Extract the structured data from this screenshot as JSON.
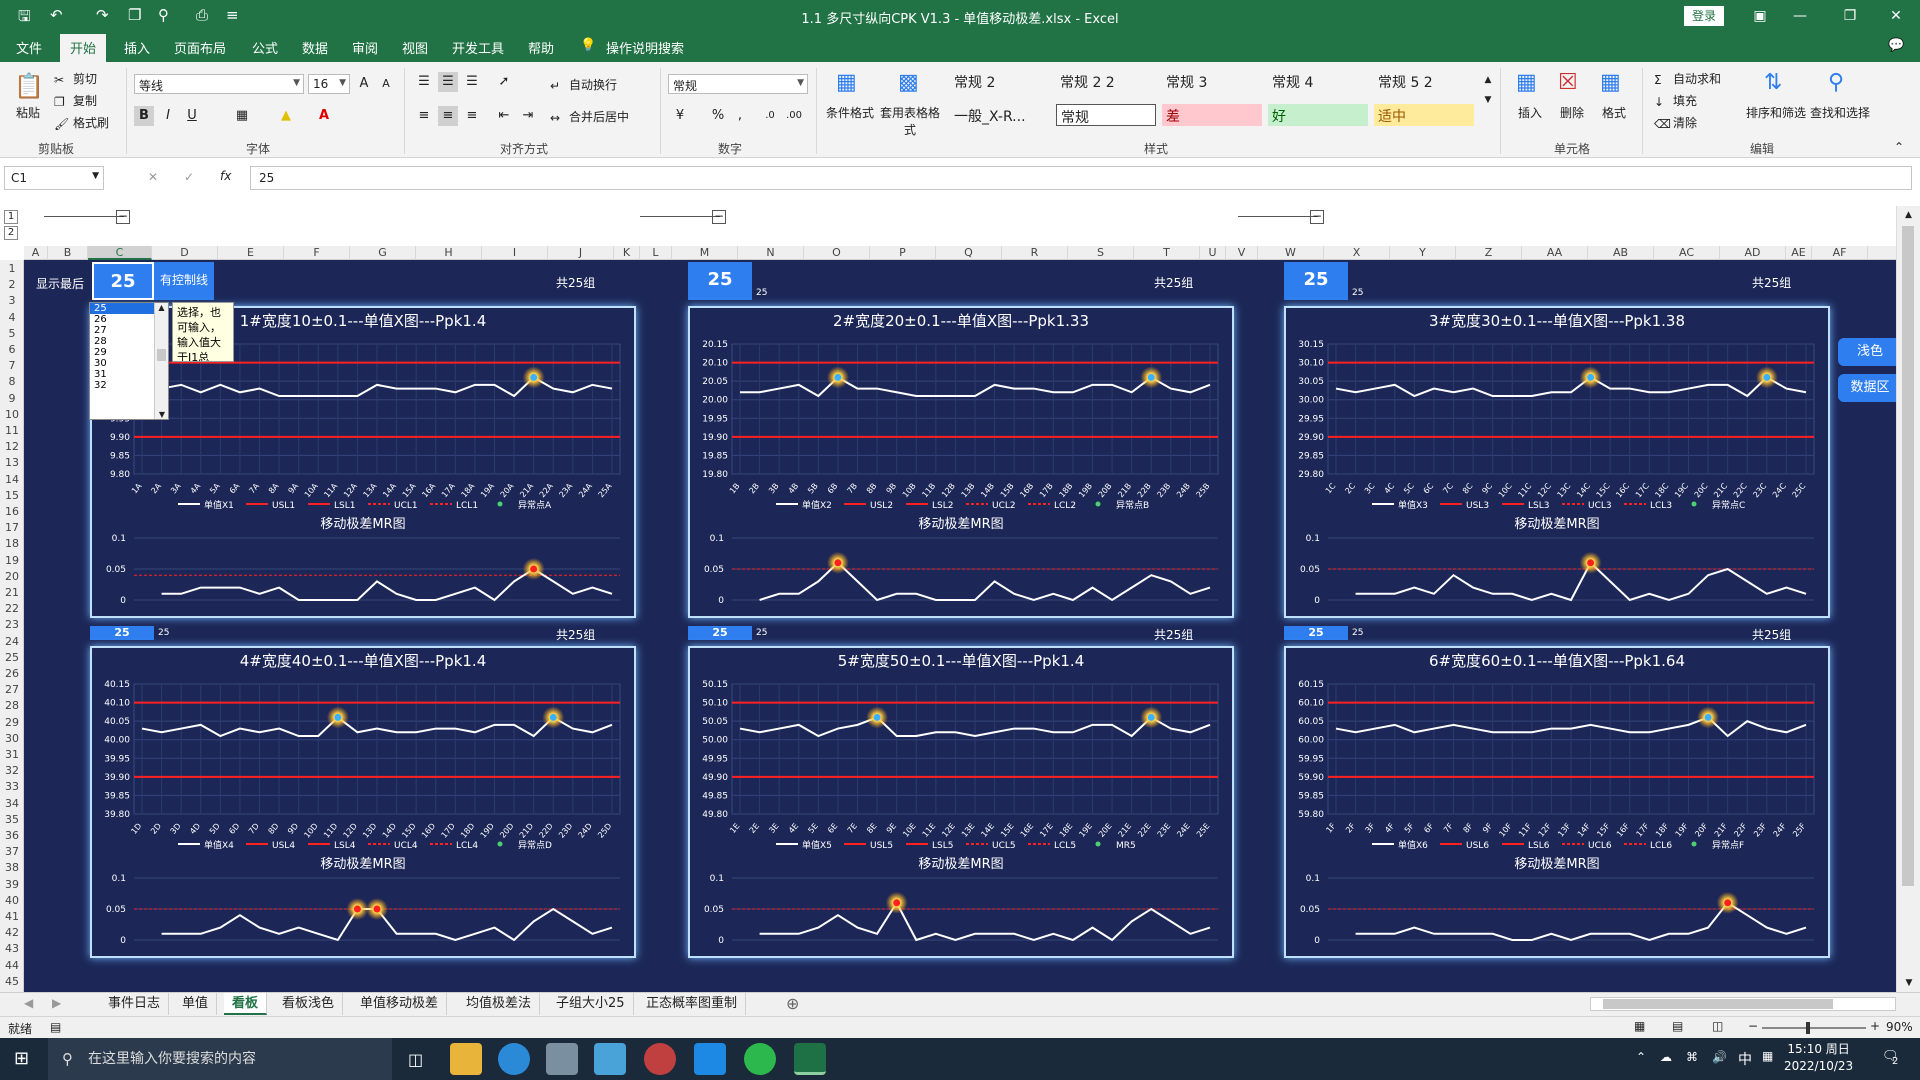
{
  "window": {
    "title": "1.1 多尺寸纵向CPK V1.3 - 单值移动极差.xlsx  -  Excel",
    "login": "登录"
  },
  "ribbon_tabs": [
    "文件",
    "开始",
    "插入",
    "页面布局",
    "公式",
    "数据",
    "审阅",
    "视图",
    "开发工具",
    "帮助",
    "操作说明搜索"
  ],
  "ribbon": {
    "clipboard": {
      "paste": "粘贴",
      "cut": "剪切",
      "copy": "复制",
      "format_painter": "格式刷",
      "group": "剪贴板"
    },
    "font": {
      "name": "等线",
      "size": "16",
      "bold": "B",
      "italic": "I",
      "underline": "U",
      "grow": "A",
      "shrink": "A",
      "group": "字体"
    },
    "alignment": {
      "wrap": "自动换行",
      "merge": "合并后居中",
      "group": "对齐方式"
    },
    "number": {
      "format": "常规",
      "percent": "%",
      "comma": ",",
      "group": "数字"
    },
    "styles": {
      "conditional": "条件格式",
      "table": "套用表格格式",
      "cells": [
        {
          "label": "常规 2",
          "bg": "#f3f3f3",
          "fg": "#222222"
        },
        {
          "label": "常规 2 2",
          "bg": "#f3f3f3",
          "fg": "#222222"
        },
        {
          "label": "常规 3",
          "bg": "#f3f3f3",
          "fg": "#222222"
        },
        {
          "label": "常规 4",
          "bg": "#f3f3f3",
          "fg": "#222222"
        },
        {
          "label": "常规 5 2",
          "bg": "#f3f3f3",
          "fg": "#222222"
        },
        {
          "label": "一般_X-R...",
          "bg": "#f3f3f3",
          "fg": "#222222"
        },
        {
          "label": "常规",
          "bg": "#ffffff",
          "fg": "#222222"
        },
        {
          "label": "差",
          "bg": "#ffc7ce",
          "fg": "#9c0006"
        },
        {
          "label": "好",
          "bg": "#c6efce",
          "fg": "#006100"
        },
        {
          "label": "适中",
          "bg": "#ffeb9c",
          "fg": "#9c5700"
        }
      ],
      "group": "样式"
    },
    "cells_group": {
      "insert": "插入",
      "delete": "删除",
      "format": "格式",
      "group": "单元格"
    },
    "editing": {
      "autosum": "自动求和",
      "fill": "填充",
      "clear": "清除",
      "sort": "排序和筛选",
      "find": "查找和选择",
      "group": "编辑"
    }
  },
  "formula_bar": {
    "namebox": "C1",
    "value": "25",
    "fx": "fx"
  },
  "columns": [
    "A",
    "B",
    "C",
    "D",
    "E",
    "F",
    "G",
    "H",
    "I",
    "J",
    "K",
    "L",
    "M",
    "N",
    "O",
    "P",
    "Q",
    "R",
    "S",
    "T",
    "U",
    "V",
    "W",
    "X",
    "Y",
    "Z",
    "AA",
    "AB",
    "AC",
    "AD",
    "AE",
    "AF"
  ],
  "rows": [
    "1",
    "2",
    "3",
    "4",
    "5",
    "6",
    "7",
    "8",
    "9",
    "10",
    "11",
    "12",
    "13",
    "14",
    "15",
    "16",
    "17",
    "18",
    "19",
    "20",
    "21",
    "22",
    "23",
    "24",
    "25",
    "26",
    "27",
    "28",
    "29",
    "30",
    "31",
    "32",
    "33",
    "34",
    "35",
    "36",
    "37",
    "38",
    "39",
    "40",
    "41",
    "42",
    "43",
    "44",
    "45"
  ],
  "top_row": {
    "show_last_label": "显示最后",
    "value": "25",
    "control_line_label": "有控制线",
    "total_groups": "共25组",
    "small_value": "25"
  },
  "dropdown": {
    "options": [
      "25",
      "26",
      "27",
      "28",
      "29",
      "30",
      "31",
      "32"
    ],
    "selected": "25",
    "tooltip": "选择，也可输入，输入值大于J1总"
  },
  "side_buttons": {
    "light": "浅色",
    "data": "数据区"
  },
  "mr_title": "移动极差MR图",
  "mr_ticks": [
    "0.1",
    "0.05",
    "0"
  ],
  "charts": [
    {
      "title": "1#宽度10±0.1---单值X图---Ppk1.4",
      "suffix": "A",
      "yticks": [
        "10.15",
        "10.10",
        "10.05",
        "10.00",
        "9.95",
        "9.90",
        "9.85",
        "9.80"
      ],
      "legend": [
        "单值X1",
        "USL1",
        "LSL1",
        "UCL1",
        "LCL1",
        "异常点A"
      ],
      "chart_data": {
        "type": "line",
        "x": [
          "1A",
          "2A",
          "3A",
          "4A",
          "5A",
          "6A",
          "7A",
          "8A",
          "9A",
          "10A",
          "11A",
          "12A",
          "13A",
          "14A",
          "15A",
          "16A",
          "17A",
          "18A",
          "19A",
          "20A",
          "21A",
          "22A",
          "23A",
          "24A",
          "25A"
        ],
        "values": [
          10.02,
          10.03,
          10.04,
          10.02,
          10.04,
          10.02,
          10.03,
          10.01,
          10.01,
          10.01,
          10.01,
          10.01,
          10.04,
          10.03,
          10.03,
          10.03,
          10.02,
          10.04,
          10.04,
          10.01,
          10.06,
          10.03,
          10.02,
          10.04,
          10.03
        ],
        "usl": 10.1,
        "lsl": 9.9,
        "ylim": [
          9.8,
          10.15
        ],
        "anomaly_index": [
          20
        ],
        "mr": [
          0.01,
          0.01,
          0.02,
          0.02,
          0.02,
          0.01,
          0.02,
          0,
          0,
          0,
          0,
          0.03,
          0.01,
          0,
          0,
          0.01,
          0.02,
          0,
          0.03,
          0.05,
          0.03,
          0.01,
          0.02,
          0.01
        ],
        "mr_anomaly": [
          19
        ],
        "mr_limit": 0.04,
        "mr_ylim": [
          0,
          0.1
        ]
      }
    },
    {
      "title": "2#宽度20±0.1---单值X图---Ppk1.33",
      "suffix": "B",
      "yticks": [
        "20.15",
        "20.10",
        "20.05",
        "20.00",
        "19.95",
        "19.90",
        "19.85",
        "19.80"
      ],
      "legend": [
        "单值X2",
        "USL2",
        "LSL2",
        "UCL2",
        "LCL2",
        "异常点B"
      ],
      "chart_data": {
        "type": "line",
        "x": [
          "1B",
          "2B",
          "3B",
          "4B",
          "5B",
          "6B",
          "7B",
          "8B",
          "9B",
          "10B",
          "11B",
          "12B",
          "13B",
          "14B",
          "15B",
          "16B",
          "17B",
          "18B",
          "19B",
          "20B",
          "21B",
          "22B",
          "23B",
          "24B",
          "25B"
        ],
        "values": [
          20.02,
          20.02,
          20.03,
          20.04,
          20.01,
          20.06,
          20.03,
          20.03,
          20.02,
          20.01,
          20.01,
          20.01,
          20.01,
          20.04,
          20.03,
          20.03,
          20.02,
          20.02,
          20.04,
          20.04,
          20.02,
          20.06,
          20.03,
          20.02,
          20.04
        ],
        "usl": 20.1,
        "lsl": 19.9,
        "ylim": [
          19.8,
          20.15
        ],
        "anomaly_index": [
          5,
          21
        ],
        "mr": [
          0,
          0.01,
          0.01,
          0.03,
          0.06,
          0.03,
          0,
          0.01,
          0.01,
          0,
          0,
          0,
          0.03,
          0.01,
          0,
          0.01,
          0,
          0.02,
          0,
          0.02,
          0.04,
          0.03,
          0.01,
          0.02
        ],
        "mr_anomaly": [
          4
        ],
        "mr_limit": 0.05,
        "mr_ylim": [
          0,
          0.1
        ]
      }
    },
    {
      "title": "3#宽度30±0.1---单值X图---Ppk1.38",
      "suffix": "C",
      "yticks": [
        "30.15",
        "30.10",
        "30.05",
        "30.00",
        "29.95",
        "29.90",
        "29.85",
        "29.80"
      ],
      "legend": [
        "单值X3",
        "USL3",
        "LSL3",
        "UCL3",
        "LCL3",
        "异常点C"
      ],
      "chart_data": {
        "type": "line",
        "x": [
          "1C",
          "2C",
          "3C",
          "4C",
          "5C",
          "6C",
          "7C",
          "8C",
          "9C",
          "10C",
          "11C",
          "12C",
          "13C",
          "14C",
          "15C",
          "16C",
          "17C",
          "18C",
          "19C",
          "20C",
          "21C",
          "22C",
          "23C",
          "24C",
          "25C"
        ],
        "values": [
          30.03,
          30.02,
          30.03,
          30.04,
          30.01,
          30.03,
          30.02,
          30.03,
          30.01,
          30.01,
          30.01,
          30.02,
          30.02,
          30.06,
          30.03,
          30.03,
          30.02,
          30.02,
          30.03,
          30.04,
          30.04,
          30.01,
          30.06,
          30.03,
          30.02
        ],
        "usl": 30.1,
        "lsl": 29.9,
        "ylim": [
          29.8,
          30.15
        ],
        "anomaly_index": [
          13,
          22
        ],
        "mr": [
          0.01,
          0.01,
          0.01,
          0.02,
          0.01,
          0.04,
          0.02,
          0.01,
          0.01,
          0,
          0.01,
          0,
          0.06,
          0.03,
          0,
          0.01,
          0,
          0.01,
          0.04,
          0.05,
          0.03,
          0.01,
          0.02,
          0.01
        ],
        "mr_anomaly": [
          12
        ],
        "mr_limit": 0.05,
        "mr_ylim": [
          0,
          0.1
        ]
      }
    },
    {
      "title": "4#宽度40±0.1---单值X图---Ppk1.4",
      "suffix": "D",
      "yticks": [
        "40.15",
        "40.10",
        "40.05",
        "40.00",
        "39.95",
        "39.90",
        "39.85",
        "39.80"
      ],
      "legend": [
        "单值X4",
        "USL4",
        "LSL4",
        "UCL4",
        "LCL4",
        "异常点D"
      ],
      "chart_data": {
        "type": "line",
        "x": [
          "1D",
          "2D",
          "3D",
          "4D",
          "5D",
          "6D",
          "7D",
          "8D",
          "9D",
          "10D",
          "11D",
          "12D",
          "13D",
          "14D",
          "15D",
          "16D",
          "17D",
          "18D",
          "19D",
          "20D",
          "21D",
          "22D",
          "23D",
          "24D",
          "25D"
        ],
        "values": [
          40.03,
          40.02,
          40.03,
          40.04,
          40.01,
          40.03,
          40.02,
          40.03,
          40.01,
          40.01,
          40.06,
          40.02,
          40.03,
          40.02,
          40.02,
          40.03,
          40.03,
          40.02,
          40.04,
          40.04,
          40.01,
          40.06,
          40.03,
          40.02,
          40.04
        ],
        "usl": 40.1,
        "lsl": 39.9,
        "ylim": [
          39.8,
          40.15
        ],
        "anomaly_index": [
          10,
          21
        ],
        "mr": [
          0.01,
          0.01,
          0.01,
          0.02,
          0.04,
          0.02,
          0.01,
          0.02,
          0.01,
          0,
          0.05,
          0.05,
          0.01,
          0.01,
          0.01,
          0,
          0.01,
          0.02,
          0,
          0.03,
          0.05,
          0.03,
          0.01,
          0.02
        ],
        "mr_anomaly": [
          10,
          11
        ],
        "mr_limit": 0.05,
        "mr_ylim": [
          0,
          0.1
        ]
      }
    },
    {
      "title": "5#宽度50±0.1---单值X图---Ppk1.4",
      "suffix": "E",
      "yticks": [
        "50.15",
        "50.10",
        "50.05",
        "50.00",
        "49.95",
        "49.90",
        "49.85",
        "49.80"
      ],
      "legend": [
        "单值X5",
        "USL5",
        "LSL5",
        "UCL5",
        "LCL5",
        "MR5"
      ],
      "chart_data": {
        "type": "line",
        "x": [
          "1E",
          "2E",
          "3E",
          "4E",
          "5E",
          "6E",
          "7E",
          "8E",
          "9E",
          "10E",
          "11E",
          "12E",
          "13E",
          "14E",
          "15E",
          "16E",
          "17E",
          "18E",
          "19E",
          "20E",
          "21E",
          "22E",
          "23E",
          "24E",
          "25E"
        ],
        "values": [
          50.03,
          50.02,
          50.03,
          50.04,
          50.01,
          50.03,
          50.04,
          50.06,
          50.01,
          50.01,
          50.02,
          50.02,
          50.01,
          50.02,
          50.03,
          50.03,
          50.02,
          50.02,
          50.04,
          50.04,
          50.01,
          50.06,
          50.03,
          50.02,
          50.04
        ],
        "usl": 50.1,
        "lsl": 49.9,
        "ylim": [
          49.8,
          50.15
        ],
        "anomaly_index": [
          7,
          21
        ],
        "mr": [
          0.01,
          0.01,
          0.01,
          0.02,
          0.04,
          0.02,
          0.01,
          0.06,
          0,
          0.01,
          0,
          0.01,
          0.01,
          0.01,
          0,
          0.01,
          0,
          0.02,
          0,
          0.03,
          0.05,
          0.03,
          0.01,
          0.02
        ],
        "mr_anomaly": [
          7
        ],
        "mr_limit": 0.05,
        "mr_ylim": [
          0,
          0.1
        ]
      }
    },
    {
      "title": "6#宽度60±0.1---单值X图---Ppk1.64",
      "suffix": "F",
      "yticks": [
        "60.15",
        "60.10",
        "60.05",
        "60.00",
        "59.95",
        "59.90",
        "59.85",
        "59.80"
      ],
      "legend": [
        "单值X6",
        "USL6",
        "LSL6",
        "UCL6",
        "LCL6",
        "异常点F"
      ],
      "chart_data": {
        "type": "line",
        "x": [
          "1F",
          "2F",
          "3F",
          "4F",
          "5F",
          "6F",
          "7F",
          "8F",
          "9F",
          "10F",
          "11F",
          "12F",
          "13F",
          "14F",
          "15F",
          "16F",
          "17F",
          "18F",
          "19F",
          "20F",
          "21F",
          "22F",
          "23F",
          "24F",
          "25F"
        ],
        "values": [
          60.03,
          60.02,
          60.03,
          60.04,
          60.02,
          60.03,
          60.04,
          60.03,
          60.02,
          60.02,
          60.02,
          60.03,
          60.03,
          60.04,
          60.03,
          60.02,
          60.02,
          60.03,
          60.04,
          60.06,
          60.01,
          60.05,
          60.03,
          60.02,
          60.04
        ],
        "usl": 60.1,
        "lsl": 59.9,
        "ylim": [
          59.8,
          60.15
        ],
        "anomaly_index": [
          19
        ],
        "mr": [
          0.01,
          0.01,
          0.01,
          0.02,
          0.01,
          0.01,
          0.01,
          0.01,
          0,
          0,
          0.01,
          0,
          0.01,
          0.01,
          0.01,
          0,
          0.01,
          0.01,
          0.02,
          0.06,
          0.04,
          0.02,
          0.01,
          0.02
        ],
        "mr_anomaly": [
          19
        ],
        "mr_limit": 0.05,
        "mr_ylim": [
          0,
          0.1
        ]
      }
    }
  ],
  "sheet_tabs": [
    "事件日志",
    "单值",
    "看板",
    "看板浅色",
    "单值移动极差",
    "均值极差法",
    "子组大小25",
    "正态概率图重制"
  ],
  "active_sheet": "看板",
  "status": {
    "ready": "就绪",
    "zoom": "90%"
  },
  "taskbar": {
    "search": "在这里输入你要搜索的内容",
    "time": "15:10 周日",
    "date": "2022/10/23",
    "ime": "中",
    "notif": "2"
  },
  "colors": {
    "sheet_bg": "#1c2757",
    "accent": "#2f7ef0",
    "excel_green": "#217346",
    "limit_red": "#ff2020",
    "panel_glow": "#6fb6ff"
  }
}
